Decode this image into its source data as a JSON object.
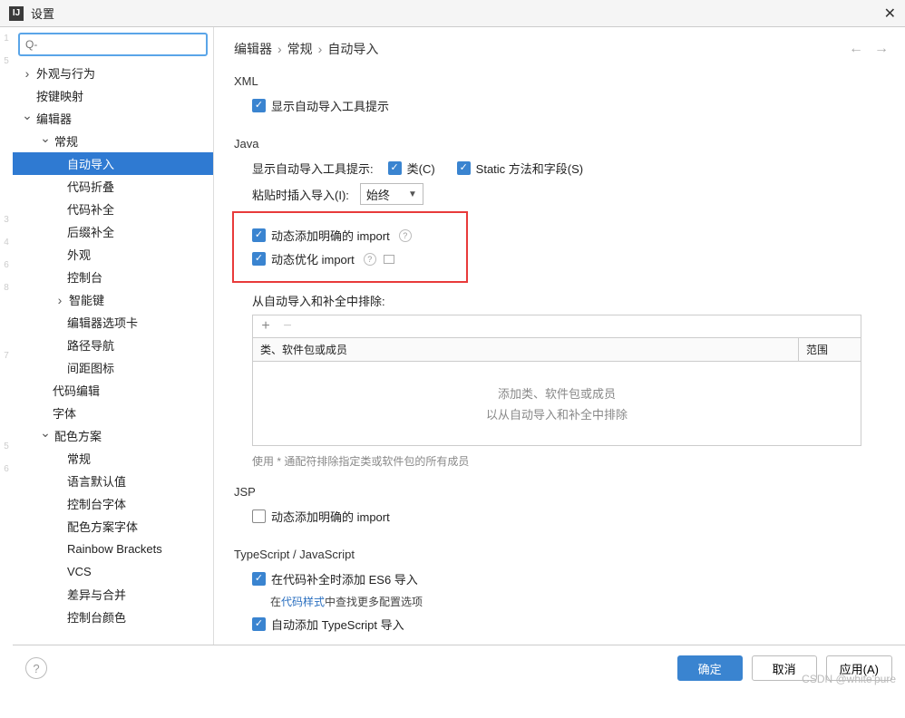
{
  "title": "设置",
  "search_placeholder": "Q-",
  "breadcrumb": {
    "b0": "编辑器",
    "b1": "常规",
    "b2": "自动导入"
  },
  "tree": {
    "appearance": "外观与行为",
    "keymap": "按键映射",
    "editor": "编辑器",
    "general": "常规",
    "auto_import": "自动导入",
    "code_folding": "代码折叠",
    "code_completion": "代码补全",
    "postfix": "后缀补全",
    "appearance2": "外观",
    "console": "控制台",
    "smart_keys": "智能键",
    "editor_tabs": "编辑器选项卡",
    "path_nav": "路径导航",
    "gutter": "间距图标",
    "code_editing": "代码编辑",
    "font": "字体",
    "color_scheme": "配色方案",
    "cs_general": "常规",
    "cs_lang_default": "语言默认值",
    "cs_console_font": "控制台字体",
    "cs_color_scheme_font": "配色方案字体",
    "cs_rainbow": "Rainbow Brackets",
    "cs_vcs": "VCS",
    "cs_diff": "差异与合并",
    "cs_console_colors": "控制台颜色"
  },
  "sections": {
    "xml_title": "XML",
    "xml_show_tooltip": "显示自动导入工具提示",
    "java_title": "Java",
    "java_show_tooltip_label": "显示自动导入工具提示:",
    "java_class": "类(C)",
    "java_static": "Static 方法和字段(S)",
    "java_paste_label": "粘贴时插入导入(I):",
    "java_paste_value": "始终",
    "java_add_unambiguous": "动态添加明确的 import",
    "java_optimize": "动态优化 import",
    "java_exclude_label": "从自动导入和补全中排除:",
    "exclude_col1": "类、软件包或成员",
    "exclude_col2": "范围",
    "exclude_empty1": "添加类、软件包或成员",
    "exclude_empty2": "以从自动导入和补全中排除",
    "exclude_hint": "使用 * 通配符排除指定类或软件包的所有成员",
    "jsp_title": "JSP",
    "jsp_add": "动态添加明确的 import",
    "ts_title": "TypeScript / JavaScript",
    "ts_es6": "在代码补全时添加 ES6 导入",
    "ts_es6_sub_pre": "在",
    "ts_es6_sub_link": "代码样式",
    "ts_es6_sub_post": "中查找更多配置选项",
    "ts_auto": "自动添加 TypeScript 导入"
  },
  "footer": {
    "ok": "确定",
    "cancel": "取消",
    "apply": "应用(A)"
  },
  "watermark": "CSDN @white'pure"
}
